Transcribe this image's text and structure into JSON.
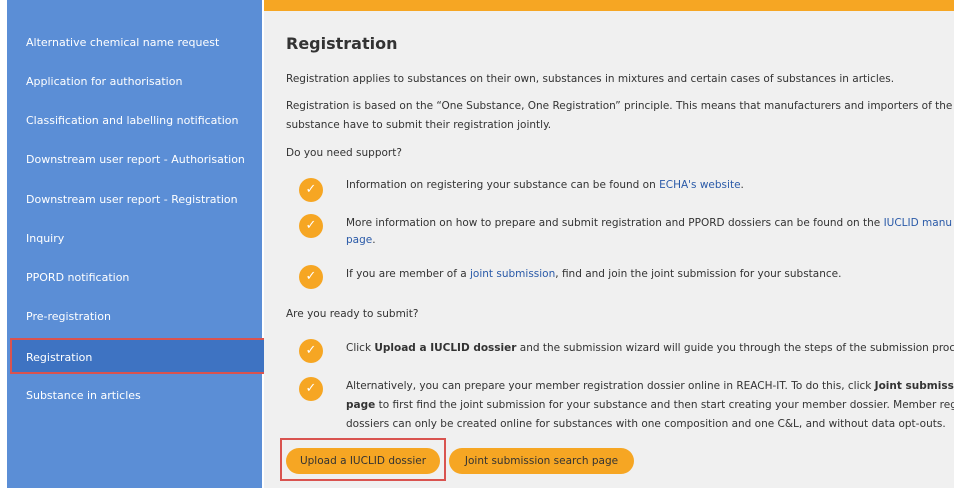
{
  "sidebar": {
    "items": [
      {
        "label": "Alternative chemical name request"
      },
      {
        "label": "Application for authorisation"
      },
      {
        "label": "Classification and labelling notification"
      },
      {
        "label": "Downstream user report - Authorisation"
      },
      {
        "label": "Downstream user report - Registration"
      },
      {
        "label": "Inquiry"
      },
      {
        "label": "PPORD notification"
      },
      {
        "label": "Pre-registration"
      },
      {
        "label": "Registration"
      },
      {
        "label": "Substance in articles"
      }
    ]
  },
  "main": {
    "title": "Registration",
    "intro1": "Registration applies to substances on their own, substances in mixtures and certain cases of substances in articles.",
    "intro2a": "Registration is based on the “One Substance, One Registration” principle. This means that manufacturers and importers of the sa",
    "intro2b": "substance have to submit their registration jointly.",
    "support_heading": "Do you need support?",
    "support1_a": "Information on registering your substance can be found on ",
    "support1_link": "ECHA's website",
    "support1_b": ".",
    "support2_a": "More information on how to prepare and submit registration and PPORD dossiers can be found on the ",
    "support2_link": "IUCLID manu",
    "support2_link2": "page",
    "support2_b": ".",
    "support3_a": "If you are member of a ",
    "support3_link": "joint submission",
    "support3_b": ", find and join the joint submission for your substance.",
    "ready_heading": "Are you ready to submit?",
    "ready1_a": "Click ",
    "ready1_bold": "Upload a IUCLID dossier",
    "ready1_b": " and the submission wizard will guide you through the steps of the submission process",
    "ready2_line1a": "Alternatively, you can prepare your member registration dossier online in REACH-IT. To do this, click ",
    "ready2_line1bold": "Joint submission",
    "ready2_line2bold": "page",
    "ready2_line2": " to first find the joint submission for your substance and then start creating your member dossier. Member regis",
    "ready2_line3": "dossiers can only be created online for substances with one composition and one C&L, and without data opt-outs.",
    "btn_upload": "Upload a IUCLID dossier",
    "btn_joint": "Joint submission search page"
  },
  "colors": {
    "sidebar": "#5b8ed6",
    "sidebar_active": "#3e73c2",
    "accent": "#f6a623",
    "highlight_border": "#d9534f",
    "link": "#2a5aa8"
  }
}
